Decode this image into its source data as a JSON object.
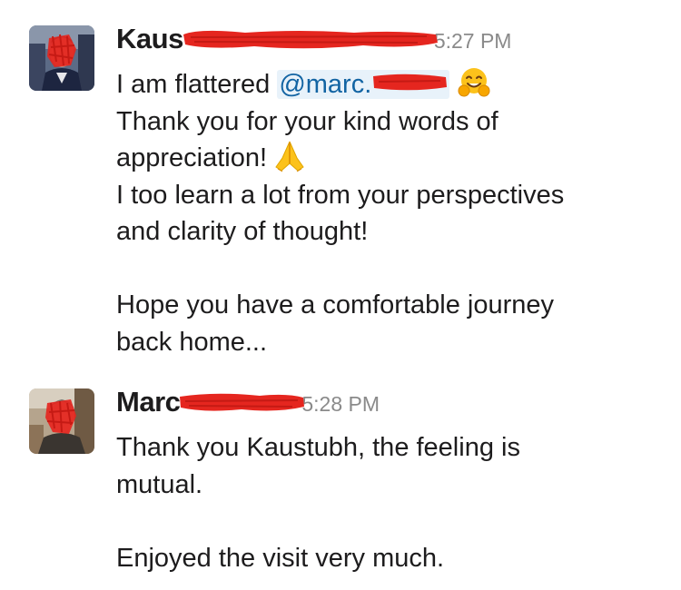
{
  "messages": [
    {
      "author": "Kaus",
      "time": "5:27 PM",
      "lines": [
        {
          "before": "I am flattered ",
          "mention": "@marc.",
          "emoji": "hugging-face"
        },
        {
          "text": "Thank you for your kind words of"
        },
        {
          "text": "appreciation!",
          "emoji": "folded-hands"
        },
        {
          "text": "I too learn a lot from your perspectives"
        },
        {
          "text": "and clarity of thought!"
        },
        {
          "text": ""
        },
        {
          "text": "Hope you have a comfortable journey"
        },
        {
          "text": "back home..."
        }
      ]
    },
    {
      "author": "Marc",
      "time": "5:28 PM",
      "lines": [
        {
          "text": "Thank you Kaustubh, the feeling is"
        },
        {
          "text": "mutual."
        },
        {
          "text": ""
        },
        {
          "text": "Enjoyed the visit very much."
        }
      ]
    }
  ],
  "colors": {
    "redaction": "#e5261f",
    "mention_bg": "#e8f2fa",
    "mention_text": "#1264a3",
    "timestamp": "#8a8a8a"
  },
  "icons": [
    "hugging-face-emoji-icon",
    "folded-hands-emoji-icon"
  ]
}
